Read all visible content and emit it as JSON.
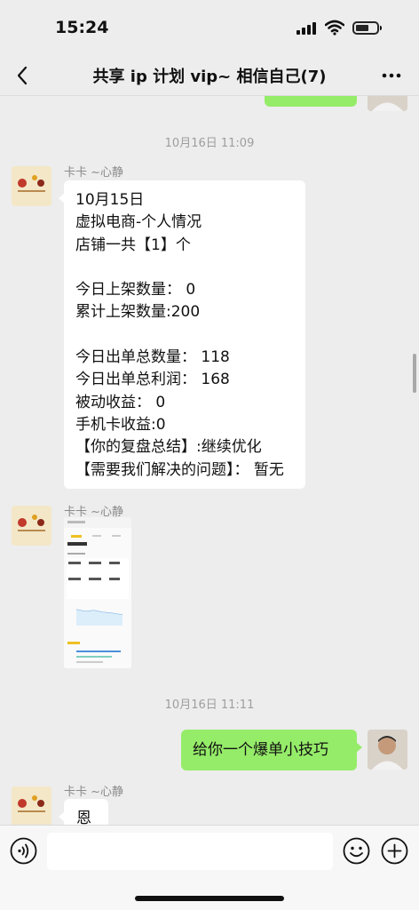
{
  "status": {
    "time": "15:24"
  },
  "nav": {
    "title": "共享 ip 计划 vip~ 相信自己(7)"
  },
  "messages": {
    "time1": "10月16日 11:09",
    "sender1": "卡卡 ~心静",
    "report_text": "10月15日\n虚拟电商-个人情况\n店铺一共【1】个\n\n今日上架数量： 0\n累计上架数量:200\n\n今日出单总数量： 118\n今日出单总利润： 168\n被动收益： 0\n手机卡收益:0\n【你的复盘总结】:继续优化\n【需要我们解决的问题】： 暂无",
    "sender2": "卡卡 ~心静",
    "time2": "10月16日 11:11",
    "outgoing": "给你一个爆单小技巧",
    "sender3": "卡卡 ~心静",
    "partial": "恩"
  },
  "input": {
    "placeholder": ""
  },
  "colors": {
    "background": "#ededed",
    "outgoing_bubble": "#95ec69",
    "incoming_bubble": "#ffffff"
  },
  "icons": [
    "back-arrow",
    "more-dots",
    "voice",
    "emoji",
    "plus"
  ]
}
